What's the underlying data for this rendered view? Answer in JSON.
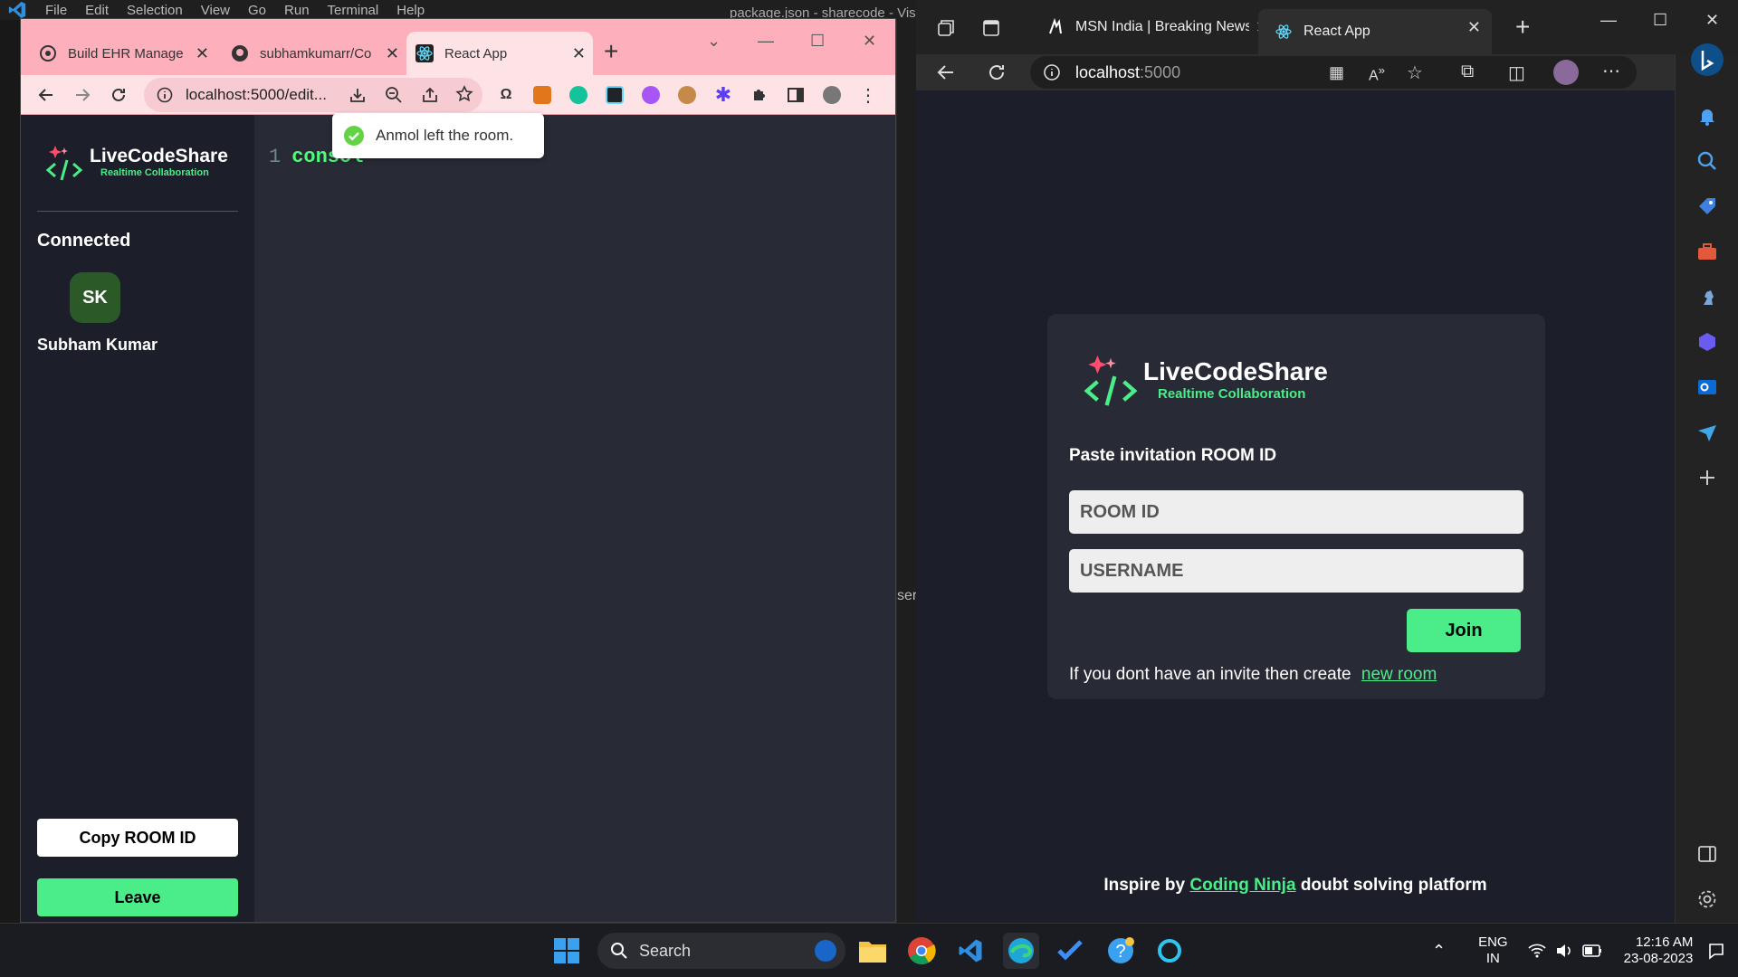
{
  "vscode": {
    "menu": [
      "File",
      "Edit",
      "Selection",
      "View",
      "Go",
      "Run",
      "Terminal",
      "Help"
    ],
    "title": "package.json - sharecode - Visu",
    "side_fragment": "ser"
  },
  "chrome": {
    "tabs": [
      {
        "label": "Build EHR Manager"
      },
      {
        "label": "subhamkumarr/Co"
      },
      {
        "label": "React App"
      }
    ],
    "new_tab": "+",
    "url": "localhost:5000/edit..."
  },
  "editor_app": {
    "brand_title": "LiveCodeShare",
    "brand_subtitle": "Realtime Collaboration",
    "connected_label": "Connected",
    "clients": [
      {
        "initials": "SK",
        "name": "Subham Kumar"
      }
    ],
    "copy_button": "Copy ROOM ID",
    "leave_button": "Leave",
    "line_number": "1",
    "code_text": "consol",
    "toast": "Anmol left the room."
  },
  "edge": {
    "tabs": [
      {
        "label": "MSN India | Breaking News,"
      },
      {
        "label": "React App"
      }
    ],
    "url_host": "localhost",
    "url_port": ":5000"
  },
  "join_page": {
    "brand_title": "LiveCodeShare",
    "brand_subtitle": "Realtime Collaboration",
    "invite_label": "Paste invitation ROOM ID",
    "room_placeholder": "ROOM ID",
    "username_placeholder": "USERNAME",
    "join_button": "Join",
    "create_info": "If you dont have an invite then create",
    "new_room_link": "new room",
    "footer_prefix": "Inspire by",
    "footer_link": "Coding Ninja",
    "footer_suffix": "doubt solving platform"
  },
  "taskbar": {
    "search_label": "Search",
    "lang_top": "ENG",
    "lang_bottom": "IN",
    "time": "12:16 AM",
    "date": "23-08-2023"
  },
  "colors": {
    "accent_green": "#4aed88",
    "chrome_tabstrip": "#fdb0bc",
    "editor_bg": "#282a36",
    "panel_bg": "#1c1e29"
  },
  "icons": {
    "chrome_toolbar": [
      "back-icon",
      "forward-icon",
      "reload-icon",
      "info-icon",
      "install-icon",
      "zoom-icon",
      "share-icon",
      "star-icon"
    ],
    "edge_sidebar": [
      "bell-icon",
      "search-icon",
      "tag-icon",
      "toolbox-icon",
      "chess-icon",
      "copilot-icon",
      "outlook-icon",
      "send-icon",
      "add-icon",
      "sidebar-toggle-icon",
      "settings-icon"
    ]
  }
}
